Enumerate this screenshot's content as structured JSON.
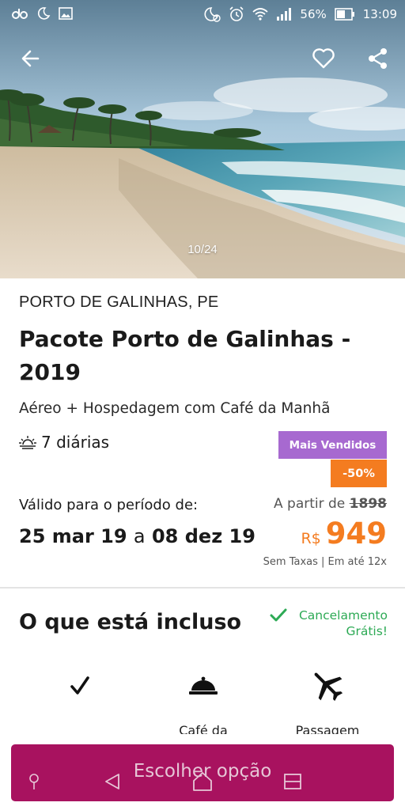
{
  "status_bar": {
    "battery": "56%",
    "time": "13:09",
    "left_icons": [
      "app-notification-icon",
      "moon-icon",
      "image-icon"
    ],
    "right_icons": [
      "do-not-disturb-icon",
      "alarm-icon",
      "wifi-icon",
      "signal-icon",
      "battery-icon"
    ]
  },
  "gallery": {
    "counter": "10/24",
    "actions": [
      "back-arrow-icon",
      "heart-icon",
      "share-icon"
    ]
  },
  "package": {
    "location": "PORTO DE GALINHAS, PE",
    "title": "Pacote Porto de Galinhas - 2019",
    "subtitle": "Aéreo + Hospedagem com Café da Manhã",
    "nights": "7 diárias",
    "nights_icon": "sunrise-icon",
    "badge": "Mais Vendidos",
    "discount": "-50%",
    "valid_label": "Válido para o período de:",
    "date_from": "25 mar 19",
    "date_sep": "a",
    "date_to": "08 dez 19",
    "from_label": "A partir de",
    "old_price": "1898",
    "currency": "R$",
    "price": "949",
    "terms": "Sem Taxas | Em até 12x"
  },
  "included": {
    "title": "O que está incluso",
    "cancel_line1": "Cancelamento",
    "cancel_line2": "Grátis!",
    "items": [
      {
        "icon": "checkmark-icon",
        "label": ""
      },
      {
        "icon": "room-service-bell-icon",
        "label": "Café da"
      },
      {
        "icon": "airplane-icon",
        "label": "Passagem"
      }
    ]
  },
  "cta": {
    "label": "Escolher opção"
  },
  "navbar": [
    "assistant-icon",
    "back-triangle-icon",
    "home-icon",
    "recents-icon"
  ],
  "colors": {
    "brand": "#a8125f",
    "badge_purple": "#a769d0",
    "discount_orange": "#f47c20",
    "cancel_green": "#2daa55"
  }
}
